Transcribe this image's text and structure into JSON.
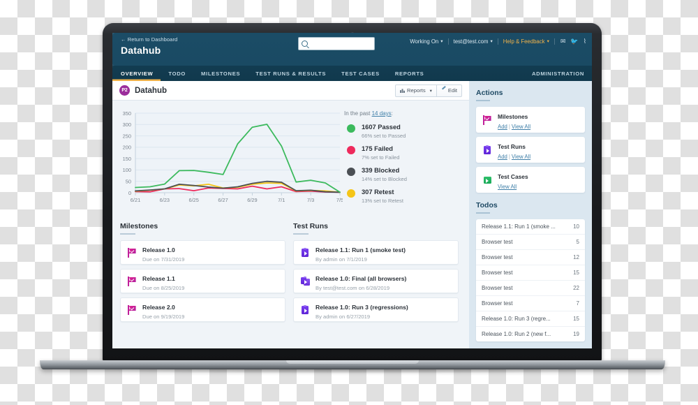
{
  "header": {
    "return_link": "← Return to Dashboard",
    "brand": "Datahub",
    "search_placeholder": "",
    "search_value": "",
    "working_on": "Working On",
    "account": "test@test.com",
    "help": "Help & Feedback",
    "icons": [
      "mail-icon",
      "twitter-icon",
      "rss-icon"
    ]
  },
  "nav": {
    "items": [
      {
        "label": "OVERVIEW",
        "active": true
      },
      {
        "label": "TODO",
        "active": false
      },
      {
        "label": "MILESTONES",
        "active": false
      },
      {
        "label": "TEST RUNS & RESULTS",
        "active": false
      },
      {
        "label": "TEST CASES",
        "active": false
      },
      {
        "label": "REPORTS",
        "active": false
      }
    ],
    "right": "ADMINISTRATION"
  },
  "project": {
    "badge": "P2",
    "title": "Datahub",
    "reports_button": "Reports",
    "edit_button": "Edit"
  },
  "chart_data": {
    "type": "line",
    "title": "",
    "xlabel": "",
    "ylabel": "",
    "ylim": [
      0,
      350
    ],
    "yticks": [
      0,
      50,
      100,
      150,
      200,
      250,
      300,
      350
    ],
    "grid": true,
    "legend": "right",
    "x": [
      "6/21",
      "6/22",
      "6/23",
      "6/24",
      "6/25",
      "6/26",
      "6/27",
      "6/28",
      "6/29",
      "6/30",
      "7/1",
      "7/2",
      "7/3",
      "7/4",
      "7/5"
    ],
    "xtick_labels": [
      "6/21",
      "6/23",
      "6/25",
      "6/27",
      "6/29",
      "7/1",
      "7/3",
      "7/5"
    ],
    "series": [
      {
        "name": "Passed",
        "color": "#3cba5d",
        "values": [
          23,
          26,
          38,
          97,
          98,
          90,
          80,
          215,
          288,
          301,
          205,
          47,
          55,
          43,
          2
        ]
      },
      {
        "name": "Blocked",
        "color": "#4b4f54",
        "values": [
          8,
          12,
          17,
          37,
          32,
          25,
          20,
          26,
          41,
          50,
          46,
          9,
          11,
          4,
          2
        ]
      },
      {
        "name": "Retest",
        "color": "#f5c518",
        "values": [
          7,
          11,
          17,
          34,
          30,
          37,
          21,
          24,
          37,
          43,
          41,
          8,
          10,
          8,
          2
        ]
      },
      {
        "name": "Failed",
        "color": "#ee2a5c",
        "values": [
          5,
          4,
          17,
          18,
          9,
          21,
          19,
          17,
          29,
          17,
          26,
          5,
          7,
          3,
          2
        ]
      }
    ]
  },
  "stats": {
    "heading_prefix": "In the past ",
    "heading_link": "14 days",
    "heading_suffix": ":",
    "rows": [
      {
        "color": "#3cba5d",
        "main": "1607 Passed",
        "sub": "66% set to Passed"
      },
      {
        "color": "#ee2a5c",
        "main": "175 Failed",
        "sub": "7% set to Failed"
      },
      {
        "color": "#4b4f54",
        "main": "339 Blocked",
        "sub": "14% set to Blocked"
      },
      {
        "color": "#f5c518",
        "main": "307 Retest",
        "sub": "13% set to Retest"
      }
    ]
  },
  "milestones": {
    "title": "Milestones",
    "items": [
      {
        "name": "Release 1.0",
        "due": "Due on 7/31/2019"
      },
      {
        "name": "Release 1.1",
        "due": "Due on 8/25/2019"
      },
      {
        "name": "Release 2.0",
        "due": "Due on 9/19/2019"
      }
    ]
  },
  "test_runs": {
    "title": "Test Runs",
    "items": [
      {
        "name": "Release 1.1: Run 1 (smoke test)",
        "meta": "By admin on 7/1/2019",
        "icon": "test-run-icon"
      },
      {
        "name": "Release 1.0: Final (all browsers)",
        "meta": "By test@test.com on 6/28/2019",
        "icon": "test-run-stack-icon"
      },
      {
        "name": "Release 1.0: Run 3 (regressions)",
        "meta": "By admin on 6/27/2019",
        "icon": "test-run-icon"
      }
    ]
  },
  "actions": {
    "title": "Actions",
    "items": [
      {
        "label": "Milestones",
        "links": [
          "Add",
          "View All"
        ],
        "icon": "flag-icon"
      },
      {
        "label": "Test Runs",
        "links": [
          "Add",
          "View All"
        ],
        "icon": "test-run-icon"
      },
      {
        "label": "Test Cases",
        "links": [
          "View All"
        ],
        "icon": "test-case-icon"
      }
    ]
  },
  "todos": {
    "title": "Todos",
    "items": [
      {
        "text": "Release 1.1: Run 1 (smoke ...",
        "count": "10"
      },
      {
        "text": "Browser test",
        "count": "5"
      },
      {
        "text": "Browser test",
        "count": "12"
      },
      {
        "text": "Browser test",
        "count": "15"
      },
      {
        "text": "Browser test",
        "count": "22"
      },
      {
        "text": "Browser test",
        "count": "7"
      },
      {
        "text": "Release 1.0: Run 3 (regre...",
        "count": "15"
      },
      {
        "text": "Release 1.0: Run 2 (new f...",
        "count": "19"
      }
    ]
  }
}
